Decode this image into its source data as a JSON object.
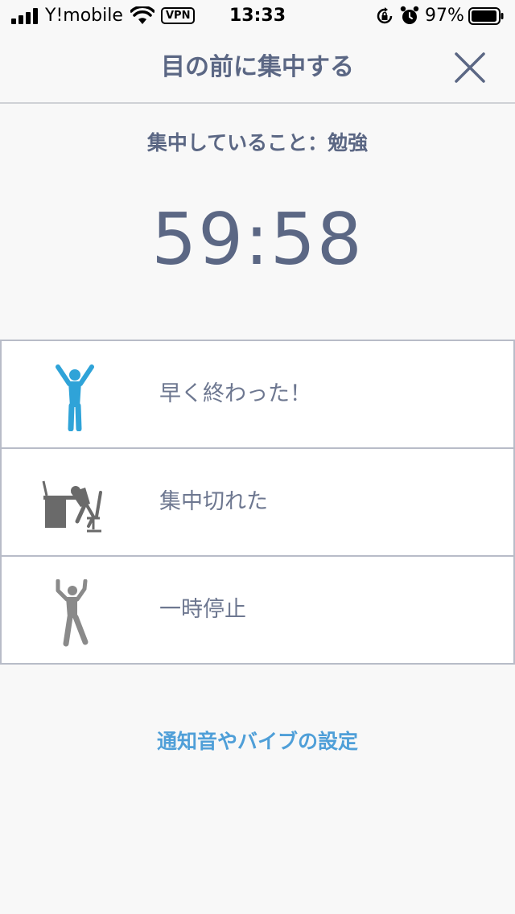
{
  "status_bar": {
    "carrier": "Y!mobile",
    "vpn": "VPN",
    "time": "13:33",
    "battery": "97%",
    "battery_level": 0.97
  },
  "nav": {
    "title": "目の前に集中する",
    "close_icon": "close-x-icon"
  },
  "subject": "集中していること：勉強",
  "timer": "59:58",
  "options": [
    {
      "label": "早く終わった！",
      "icon": "cheering-person-icon",
      "icon_color": "#2fa3d8"
    },
    {
      "label": "集中切れた",
      "icon": "exhausted-at-desk-icon",
      "icon_color": "#6a6a6a"
    },
    {
      "label": "一時停止",
      "icon": "pausing-person-icon",
      "icon_color": "#8a8a8a"
    }
  ],
  "settings_link": "通知音やバイブの設定",
  "colors": {
    "text": "#5b6784",
    "link": "#4f9fd8",
    "background": "#f8f8f8",
    "divider": "#b8bcc8"
  }
}
